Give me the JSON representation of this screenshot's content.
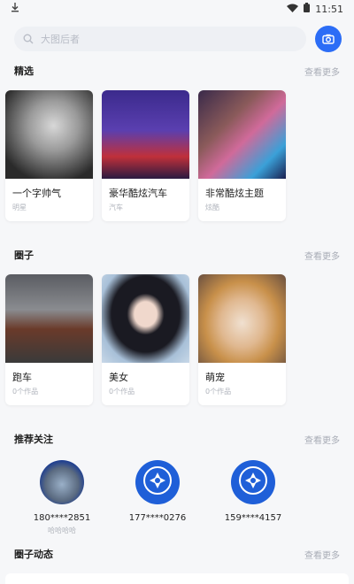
{
  "status_bar": {
    "time": "11:51"
  },
  "search": {
    "placeholder": "大图后者"
  },
  "sections": {
    "featured": {
      "title": "精选",
      "more": "查看更多",
      "cards": [
        {
          "title": "一个字帅气",
          "sub": "明星"
        },
        {
          "title": "豪华酷炫汽车",
          "sub": "汽车"
        },
        {
          "title": "非常酷炫主题",
          "sub": "炫酷"
        }
      ]
    },
    "circles": {
      "title": "圈子",
      "more": "查看更多",
      "cards": [
        {
          "title": "跑车",
          "sub": "0个作品"
        },
        {
          "title": "美女",
          "sub": "0个作品"
        },
        {
          "title": "萌宠",
          "sub": "0个作品"
        }
      ]
    },
    "recommended": {
      "title": "推荐关注",
      "more": "查看更多",
      "users": [
        {
          "name": "180****2851",
          "sub": "哈哈哈哈"
        },
        {
          "name": "177****0276",
          "sub": ""
        },
        {
          "name": "159****4157",
          "sub": ""
        }
      ]
    },
    "feed": {
      "title": "圈子动态",
      "more": "查看更多"
    }
  },
  "colors": {
    "accent": "#2c6df6",
    "avatar_blue": "#1f5fd8",
    "muted": "#a8acb6"
  }
}
